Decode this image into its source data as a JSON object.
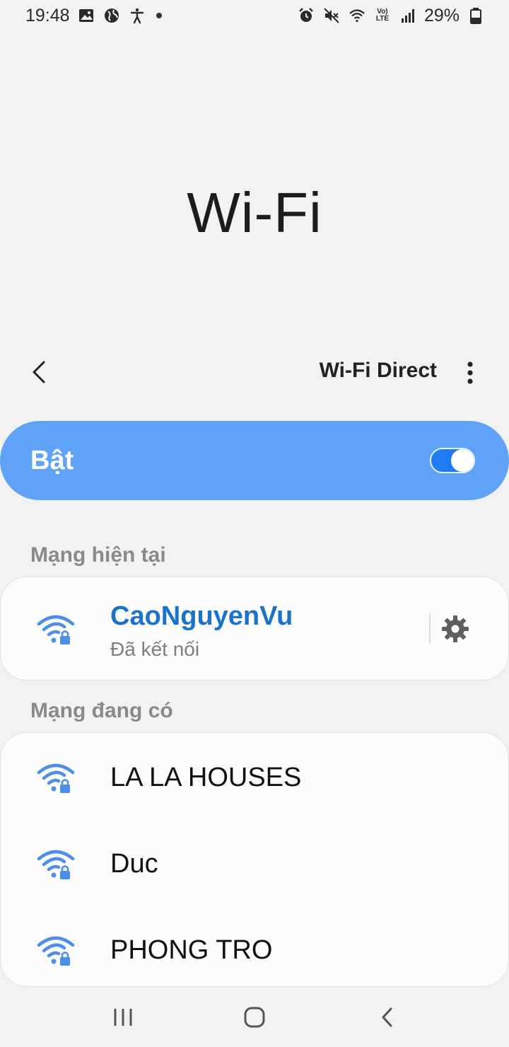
{
  "status_bar": {
    "time": "19:48",
    "battery": "29%",
    "lte_label": "Vo) LTE",
    "icons_left": [
      "image-icon",
      "globe-icon",
      "accessibility-icon",
      "dot-icon"
    ],
    "icons_right": [
      "alarm-icon",
      "mute-icon",
      "wifi-status-icon",
      "volte-icon",
      "signal-icon",
      "battery-icon"
    ]
  },
  "header": {
    "title": "Wi-Fi"
  },
  "toolbar": {
    "wifi_direct_label": "Wi-Fi Direct"
  },
  "toggle": {
    "label": "Bật",
    "state": "on"
  },
  "current_network": {
    "header": "Mạng hiện tại",
    "name": "CaoNguyenVu",
    "status": "Đã kết nối"
  },
  "available_networks": {
    "header": "Mạng đang có",
    "items": [
      {
        "name": "LA LA HOUSES"
      },
      {
        "name": "Duc"
      },
      {
        "name": "PHONG TRO"
      }
    ]
  },
  "colors": {
    "accent": "#1b73c9",
    "toggle_bar": "#5fa3f8",
    "switch": "#1f7af5",
    "wifi_icon": "#4d8fe6"
  }
}
